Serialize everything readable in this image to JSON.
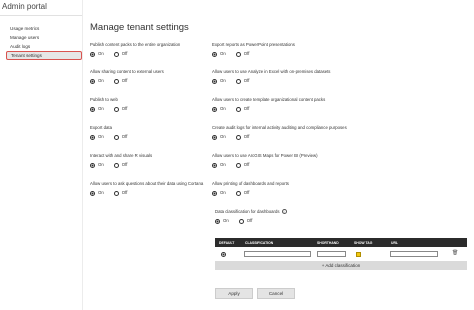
{
  "app": {
    "title": "Admin portal"
  },
  "sidebar": {
    "items": [
      {
        "label": "Usage metrics"
      },
      {
        "label": "Manage users"
      },
      {
        "label": "Audit logs"
      },
      {
        "label": "Tenant settings"
      }
    ]
  },
  "page": {
    "title": "Manage tenant settings"
  },
  "settings": {
    "left": [
      {
        "label": "Publish content packs to the entire organization",
        "value": "On"
      },
      {
        "label": "Allow sharing content to external users",
        "value": "On"
      },
      {
        "label": "Publish to web",
        "value": "On"
      },
      {
        "label": "Export data",
        "value": "On"
      },
      {
        "label": "Interact with and share R visuals",
        "value": "On"
      },
      {
        "label": "Allow users to ask questions about their data using Cortana",
        "value": "On"
      }
    ],
    "right": [
      {
        "label": "Export reports as PowerPoint presentations",
        "value": "On"
      },
      {
        "label": "Allow users to use Analyze in Excel with on-premises datasets",
        "value": "On"
      },
      {
        "label": "Allow users to create template organizational content packs",
        "value": "On"
      },
      {
        "label": "Create audit logs for internal activity auditing and compliance purposes",
        "value": "On"
      },
      {
        "label": "Allow users to use ArcGIS Maps for Power BI (Preview)",
        "value": "On"
      },
      {
        "label": "Allow printing of dashboards and reports",
        "value": "On"
      }
    ],
    "on_label": "On",
    "off_label": "Off"
  },
  "data_classification": {
    "label": "Data classification for dashboards",
    "value": "On",
    "columns": [
      "DEFAULT",
      "CLASSIFICATION",
      "SHORTHAND",
      "SHOW TAG",
      "URL"
    ],
    "add_label": "+ Add classification"
  },
  "buttons": {
    "apply": "Apply",
    "cancel": "Cancel"
  }
}
